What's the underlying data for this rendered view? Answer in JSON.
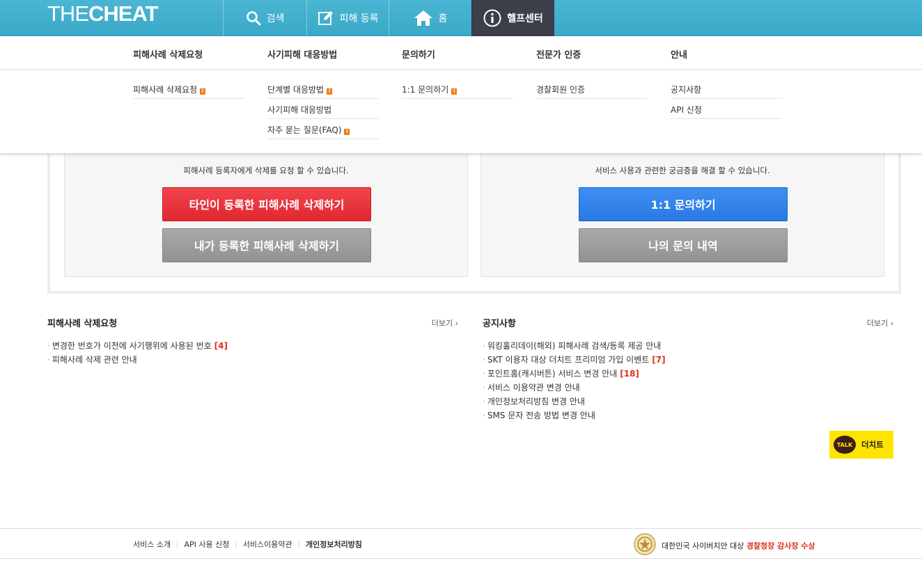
{
  "logo": {
    "light": "THE",
    "bold": "CHEAT"
  },
  "nav": {
    "search": "검색",
    "register": "피해 등록",
    "home": "홈",
    "help": "헬프센터"
  },
  "mega": {
    "columns": [
      {
        "heading": "피해사례 삭제요청",
        "items": [
          {
            "label": "피해사례 삭제요청",
            "badge": "!"
          }
        ]
      },
      {
        "heading": "사기피해 대응방법",
        "items": [
          {
            "label": "단계별 대응방법",
            "badge": "!"
          },
          {
            "label": "사기피해 대응방법"
          },
          {
            "label": "자주 묻는 질문(FAQ)",
            "badge": "!"
          }
        ]
      },
      {
        "heading": "문의하기",
        "items": [
          {
            "label": "1:1 문의하기",
            "badge": "!"
          }
        ]
      },
      {
        "heading": "전문가 인증",
        "items": [
          {
            "label": "경찰회원 인증"
          }
        ]
      },
      {
        "heading": "안내",
        "items": [
          {
            "label": "공지사항"
          },
          {
            "label": "API 신청"
          }
        ]
      }
    ]
  },
  "panels": {
    "left": {
      "desc": "피해사례 등록자에게 삭제를 요청 할 수 있습니다.",
      "btn1": "타인이 등록한 피해사례 삭제하기",
      "btn2": "내가 등록한 피해사례 삭제하기"
    },
    "right": {
      "desc": "서비스 사용과 관련한 궁금증을 해결 할 수 있습니다.",
      "btn1": "1:1 문의하기",
      "btn2": "나의 문의 내역"
    }
  },
  "deletion": {
    "title": "피해사례 삭제요청",
    "more": "더보기 ›",
    "items": [
      {
        "text": "변경한 번호가 이전에 사기행위에 사용된 번호",
        "count": "[4]"
      },
      {
        "text": "피해사례 삭제 관련 안내"
      }
    ]
  },
  "notices": {
    "title": "공지사항",
    "more": "더보기 ›",
    "items": [
      {
        "text": "워킹홀리데이(해외) 피해사례 검색/등록 제공 안내"
      },
      {
        "text": "SKT 이용자 대상 더치트 프리미엄 가입 이벤트",
        "count": "[7]"
      },
      {
        "text": "포인트홈(캐시버튼) 서비스 변경 안내",
        "count": "[18]"
      },
      {
        "text": "서비스 이용약관 변경 안내"
      },
      {
        "text": "개인정보처리방침 변경 안내"
      },
      {
        "text": "SMS 문자 전송 방법 변경 안내"
      }
    ]
  },
  "kakao": {
    "bubble": "TALK",
    "label": "더치트"
  },
  "footer": {
    "links": [
      "서비스 소개",
      "API 사용 신청",
      "서비스이용약관",
      "개인정보처리방침"
    ],
    "award_prefix": "대한민국 사이버치안 대상 ",
    "award_highlight": "경찰청장 감사장 수상"
  },
  "colors": {
    "topbar": "#3aa8c8",
    "active_tab": "#3a3f4a",
    "red": "#e0272f",
    "blue": "#2a78e4",
    "gray": "#929292",
    "kakao": "#fee500"
  }
}
